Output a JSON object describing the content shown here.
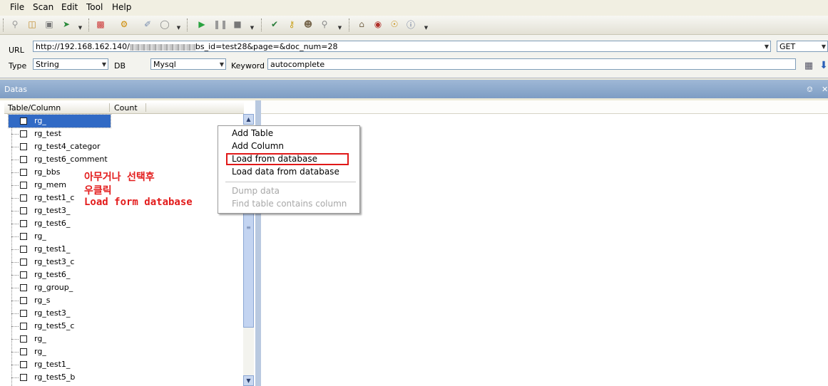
{
  "menu": [
    "File",
    "Scan",
    "Edit",
    "Tool",
    "Help"
  ],
  "form": {
    "url_label": "URL",
    "url_prefix": "http://192.168.162.140/",
    "url_suffix": "bs_id=test28&page=&doc_num=28",
    "method": "GET",
    "type_label": "Type",
    "type_value": "String",
    "db_label": "DB",
    "db_value": "Mysql",
    "keyword_label": "Keyword",
    "keyword_value": "autocomplete"
  },
  "panel": {
    "title": "Datas",
    "col_table": "Table/Column",
    "col_count": "Count"
  },
  "tree_items": [
    "rg_",
    "rg_test",
    "rg_test4_categor",
    "rg_test6_comment",
    "rg_bbs",
    "rg_mem",
    "rg_test1_c",
    "rg_test3_",
    "rg_test6_",
    "rg_",
    "rg_test1_",
    "rg_test3_c",
    "rg_test6_",
    "rg_group_",
    "rg_s",
    "rg_test3_",
    "rg_test5_c",
    "rg_",
    "rg_",
    "rg_test1_",
    "rg_test5_b"
  ],
  "annotation": {
    "line1": "아무거나 선택후",
    "line2": "우클릭",
    "line3": "Load form database"
  },
  "context_menu": {
    "add_table": "Add Table",
    "add_column": "Add Column",
    "load_from_db": "Load from database",
    "load_data_from_db": "Load data from database",
    "dump_data": "Dump data",
    "find_table": "Find table contains column"
  },
  "colors": {
    "selection": "#316ac5",
    "annotation": "#e31b1b",
    "panel_header": "#7e9dc4"
  }
}
